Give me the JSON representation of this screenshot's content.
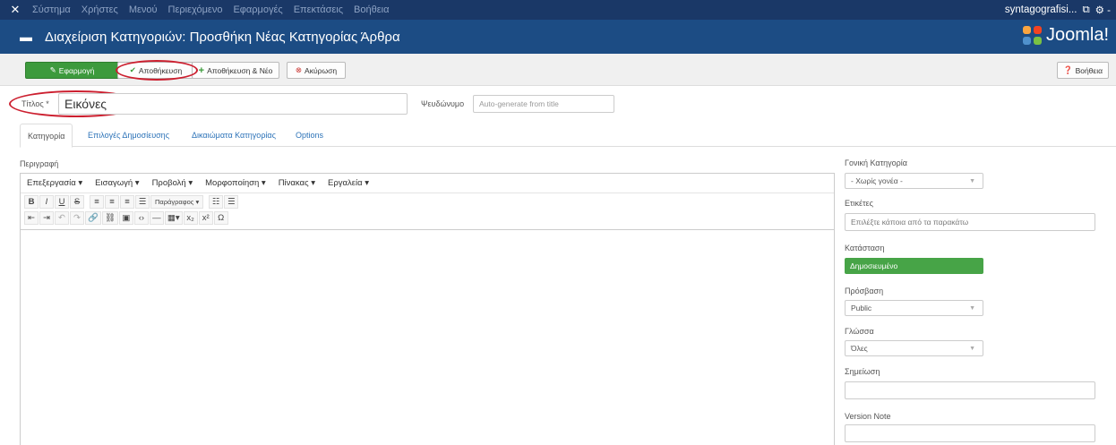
{
  "topnav": {
    "menu": [
      "Σύστημα",
      "Χρήστες",
      "Μενού",
      "Περιεχόμενο",
      "Εφαρμογές",
      "Επεκτάσεις",
      "Βοήθεια"
    ],
    "site_name": "syntagografisi...",
    "gear": "⚙ -"
  },
  "header": {
    "title": "Διαχείριση Κατηγοριών: Προσθήκη Νέας Κατηγορίας Άρθρα",
    "brand": "Joomla!"
  },
  "toolbar": {
    "apply": "Εφαρμογή",
    "save": "Αποθήκευση",
    "save_new": "Αποθήκευση & Νέο",
    "cancel": "Ακύρωση",
    "help": "Βοήθεια"
  },
  "form": {
    "title_label": "Τίτλος *",
    "title_value": "Εικόνες",
    "alias_label": "Ψευδώνυμο",
    "alias_placeholder": "Auto-generate from title"
  },
  "tabs": [
    "Κατηγορία",
    "Επιλογές Δημοσίευσης",
    "Δικαιώματα Κατηγορίας",
    "Options"
  ],
  "editor": {
    "label": "Περιγραφή",
    "menubar": [
      "Επεξεργασία ▾",
      "Εισαγωγή ▾",
      "Προβολή ▾",
      "Μορφοποίηση ▾",
      "Πίνακας ▾",
      "Εργαλεία ▾"
    ],
    "paragraph": "Παράγραφος ▾"
  },
  "sidebar": {
    "parent_label": "Γονική Κατηγορία",
    "parent_value": "- Χωρίς γονέα -",
    "tags_label": "Ετικέτες",
    "tags_placeholder": "Επιλέξτε κάποια από τα παρακάτω",
    "status_label": "Κατάσταση",
    "status_value": "Δημοσιευμένο",
    "access_label": "Πρόσβαση",
    "access_value": "Public",
    "language_label": "Γλώσσα",
    "language_value": "Όλες",
    "note_label": "Σημείωση",
    "version_label": "Version Note"
  },
  "colors": {
    "topnav": "#1a3867",
    "header": "#1c4c84",
    "apply": "#3d9a3d",
    "published": "#47a447",
    "annotation": "#cc1f2f"
  }
}
